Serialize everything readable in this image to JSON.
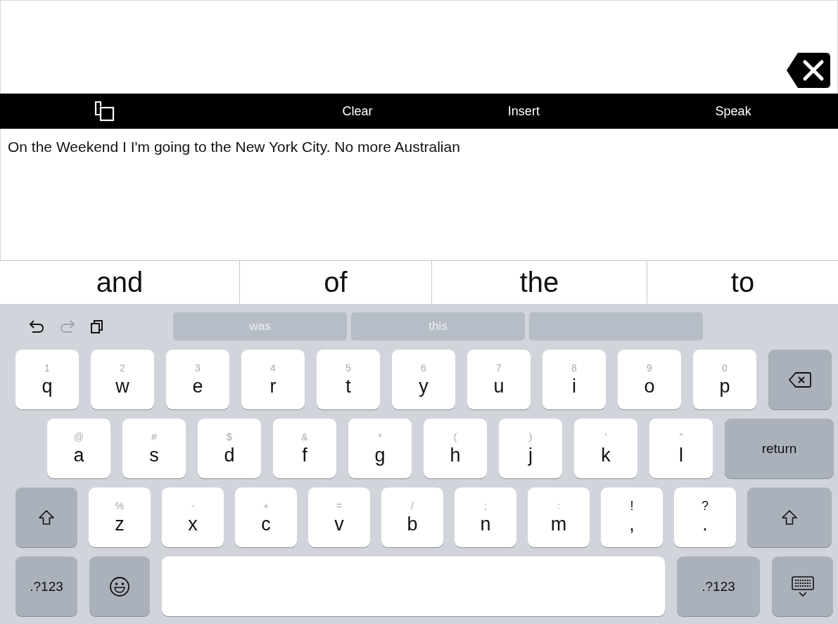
{
  "toolbar": {
    "buttons": [
      "Clear",
      "Insert",
      "Speak"
    ]
  },
  "message": "On the Weekend I I'm going to the New York City. No more Australian",
  "predictions": [
    "and",
    "of",
    "the",
    "to"
  ],
  "keyboard": {
    "undo": {
      "disabled": false
    },
    "redo": {
      "disabled": true
    },
    "suggestions": [
      {
        "kind": "word",
        "label": "was"
      },
      {
        "kind": "word",
        "label": "this"
      },
      {
        "kind": "blank"
      }
    ],
    "rows": [
      {
        "keys": [
          {
            "kind": "letter",
            "hint": "1",
            "label": "q"
          },
          {
            "kind": "letter",
            "hint": "2",
            "label": "w"
          },
          {
            "kind": "letter",
            "hint": "3",
            "label": "e"
          },
          {
            "kind": "letter",
            "hint": "4",
            "label": "r"
          },
          {
            "kind": "letter",
            "hint": "5",
            "label": "t"
          },
          {
            "kind": "letter",
            "hint": "6",
            "label": "y"
          },
          {
            "kind": "letter",
            "hint": "7",
            "label": "u"
          },
          {
            "kind": "letter",
            "hint": "8",
            "label": "i"
          },
          {
            "kind": "letter",
            "hint": "9",
            "label": "o"
          },
          {
            "kind": "letter",
            "hint": "0",
            "label": "p"
          },
          {
            "kind": "backspace"
          }
        ]
      },
      {
        "keys": [
          {
            "kind": "letter",
            "hint": "@",
            "label": "a"
          },
          {
            "kind": "letter",
            "hint": "#",
            "label": "s"
          },
          {
            "kind": "letter",
            "hint": "$",
            "label": "d"
          },
          {
            "kind": "letter",
            "hint": "&",
            "label": "f"
          },
          {
            "kind": "letter",
            "hint": "*",
            "label": "g"
          },
          {
            "kind": "letter",
            "hint": "(",
            "label": "h"
          },
          {
            "kind": "letter",
            "hint": ")",
            "label": "j"
          },
          {
            "kind": "letter",
            "hint": "’",
            "label": "k"
          },
          {
            "kind": "letter",
            "hint": "”",
            "label": "l"
          },
          {
            "kind": "return",
            "label": "return"
          }
        ]
      },
      {
        "keys": [
          {
            "kind": "shift"
          },
          {
            "kind": "letter",
            "hint": "%",
            "label": "z"
          },
          {
            "kind": "letter",
            "hint": "-",
            "label": "x"
          },
          {
            "kind": "letter",
            "hint": "+",
            "label": "c"
          },
          {
            "kind": "letter",
            "hint": "=",
            "label": "v"
          },
          {
            "kind": "letter",
            "hint": "/",
            "label": "b"
          },
          {
            "kind": "letter",
            "hint": ";",
            "label": "n"
          },
          {
            "kind": "letter",
            "hint": ":",
            "label": "m"
          },
          {
            "kind": "punct",
            "hint": "!",
            "label": ","
          },
          {
            "kind": "punct",
            "hint": "?",
            "label": "."
          },
          {
            "kind": "shift"
          }
        ]
      },
      {
        "keys": [
          {
            "kind": "mode",
            "label": ".?123"
          },
          {
            "kind": "emoji"
          },
          {
            "kind": "space"
          },
          {
            "kind": "mode",
            "label": ".?123"
          },
          {
            "kind": "hide"
          }
        ]
      }
    ]
  }
}
